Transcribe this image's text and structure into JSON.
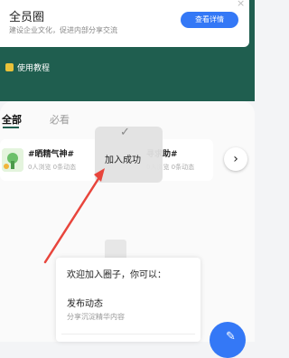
{
  "circle_card": {
    "title": "全员圈",
    "description": "建设企业文化，促进内部分享交流",
    "detail_button": "查看详情",
    "close_symbol": "×"
  },
  "tutorial": {
    "label": "使用教程"
  },
  "tabs": [
    {
      "label": "全部",
      "active": true
    },
    {
      "label": "必看",
      "active": false
    }
  ],
  "topics": [
    {
      "title": "#晒精气神#",
      "stats": "0人浏览 0条动态"
    },
    {
      "title": "寻求助#",
      "stats": "0人浏览 0条动态"
    }
  ],
  "next_symbol": "›",
  "toast": {
    "check_symbol": "✓",
    "text": "加入成功"
  },
  "welcome_menu": {
    "title": "欢迎加入圈子，你可以：",
    "items": [
      {
        "label": "发布动态",
        "sub": "分享沉淀精华内容"
      }
    ]
  },
  "fab_icon": "✎",
  "colors": {
    "header_bg": "#1f5e4f",
    "accent": "#3478f6",
    "annotation_arrow": "#e8453c"
  }
}
